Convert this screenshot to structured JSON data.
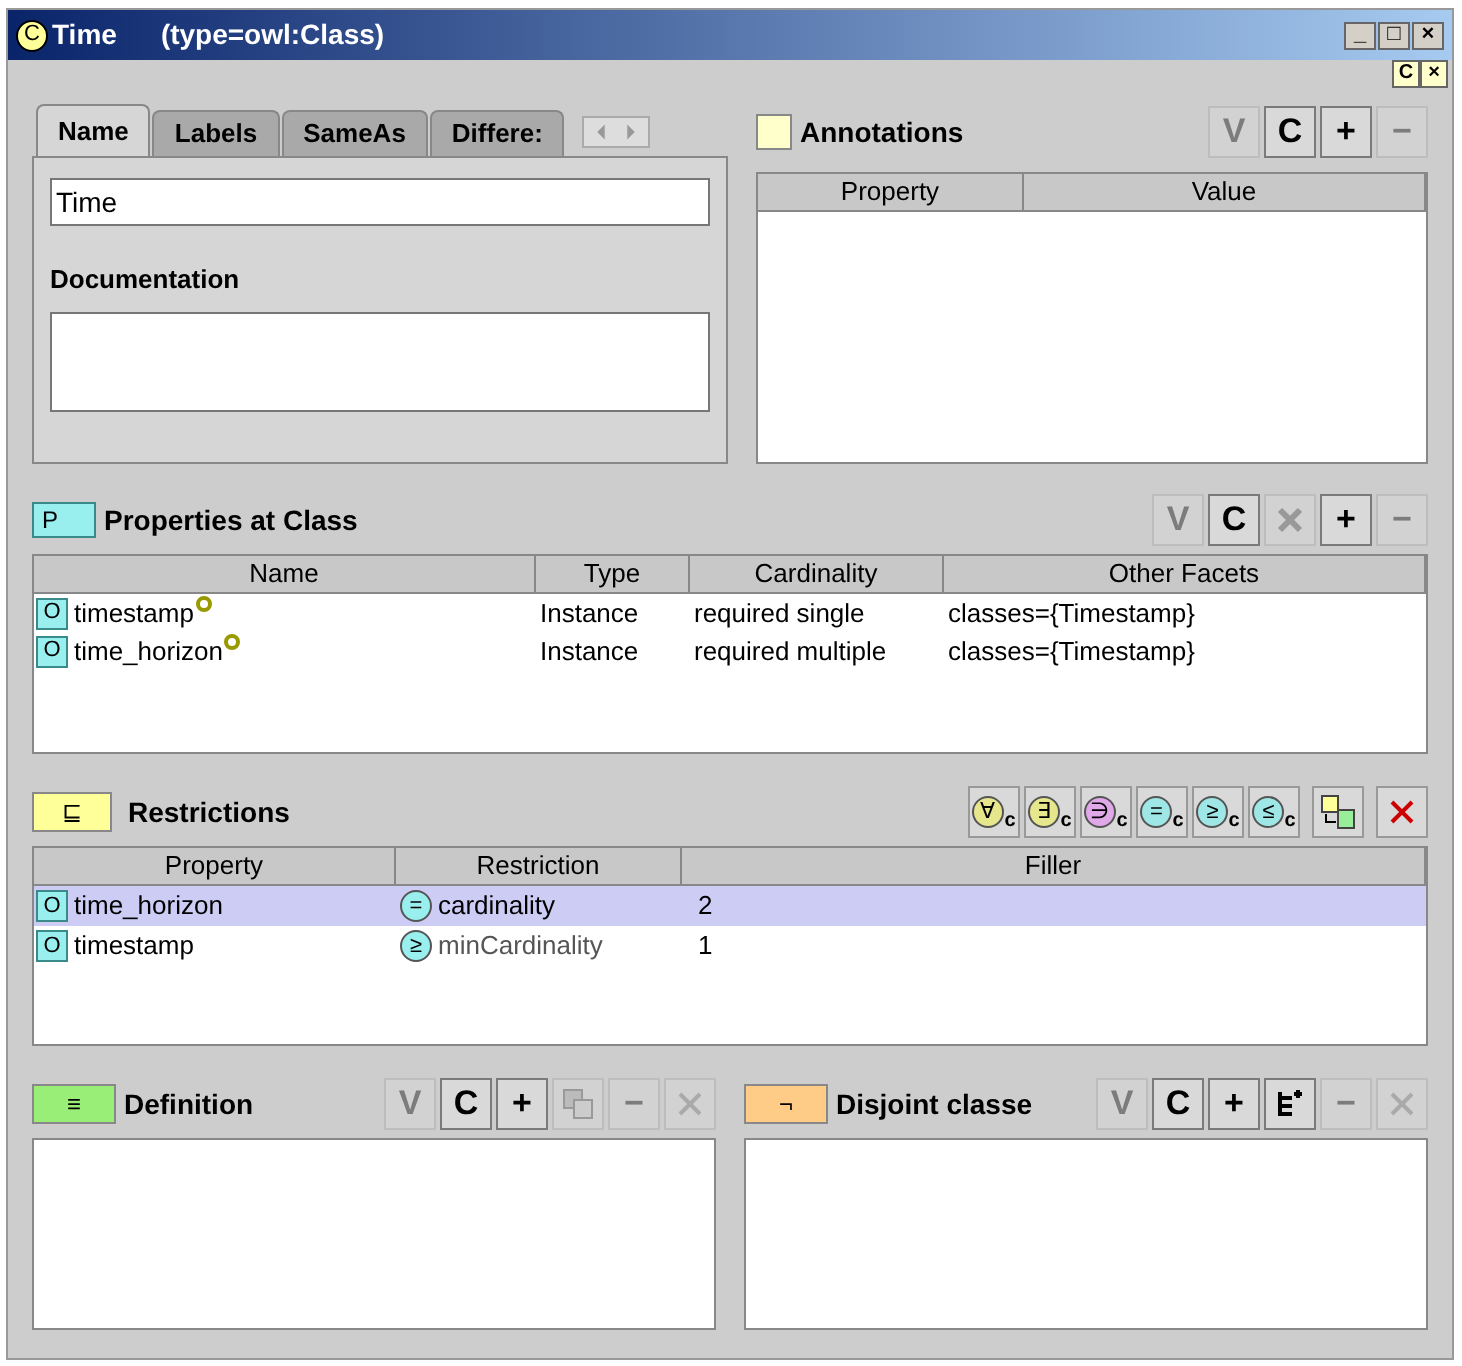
{
  "window": {
    "icon": "C",
    "title": "Time",
    "subtitle": "(type=owl:Class)",
    "controls": [
      "_",
      "□",
      "×"
    ],
    "sub_controls": [
      "C",
      "×"
    ]
  },
  "name_panel": {
    "tabs": [
      {
        "label": "Name",
        "selected": true
      },
      {
        "label": "Labels",
        "selected": false
      },
      {
        "label": "SameAs",
        "selected": false
      },
      {
        "label": "Differe:",
        "selected": false
      }
    ],
    "name_value": "Time",
    "documentation_label": "Documentation"
  },
  "annotations": {
    "title": "Annotations",
    "buttons": [
      {
        "kind": "text",
        "label": "V",
        "disabled": true
      },
      {
        "kind": "text",
        "label": "C",
        "disabled": false
      },
      {
        "kind": "text",
        "label": "+",
        "disabled": false
      },
      {
        "kind": "text",
        "label": "−",
        "disabled": true
      }
    ],
    "columns": [
      "Property",
      "Value"
    ]
  },
  "properties": {
    "icon": "P",
    "title": "Properties at Class",
    "buttons": [
      {
        "kind": "text",
        "label": "V",
        "disabled": true
      },
      {
        "kind": "text",
        "label": "C",
        "disabled": false
      },
      {
        "kind": "remove",
        "disabled": true
      },
      {
        "kind": "text",
        "label": "+",
        "disabled": false
      },
      {
        "kind": "text",
        "label": "−",
        "disabled": true
      }
    ],
    "columns": [
      "Name",
      "Type",
      "Cardinality",
      "Other Facets"
    ],
    "rows": [
      {
        "icon": "O",
        "name": "timestamp",
        "type": "Instance",
        "cardinality": "required single",
        "facets": "classes={Timestamp}"
      },
      {
        "icon": "O",
        "name": "time_horizon",
        "type": "Instance",
        "cardinality": "required multiple",
        "facets": "classes={Timestamp}"
      }
    ]
  },
  "restrictions": {
    "icon": "⊑",
    "title": "Restrictions",
    "buttons": [
      {
        "symbol": "∀",
        "sub": "c",
        "color": "#e6e68c"
      },
      {
        "symbol": "∃",
        "sub": "c",
        "color": "#e6e68c"
      },
      {
        "symbol": "∋",
        "sub": "c",
        "color": "#e0a8e8"
      },
      {
        "symbol": "=",
        "sub": "c",
        "color": "#9fe6e6"
      },
      {
        "symbol": "≥",
        "sub": "c",
        "color": "#9fe6e6"
      },
      {
        "symbol": "≤",
        "sub": "c",
        "color": "#9fe6e6"
      }
    ],
    "columns": [
      "Property",
      "Restriction",
      "Filler"
    ],
    "rows": [
      {
        "icon": "O",
        "property": "time_horizon",
        "symbol": "=",
        "restriction": "cardinality",
        "filler": "2",
        "selected": true
      },
      {
        "icon": "O",
        "property": "timestamp",
        "symbol": "≥",
        "restriction": "minCardinality",
        "filler": "1",
        "selected": false
      }
    ]
  },
  "definition": {
    "icon": "≡",
    "title": "Definition",
    "buttons": [
      {
        "kind": "text",
        "label": "V",
        "disabled": true
      },
      {
        "kind": "text",
        "label": "C",
        "disabled": false
      },
      {
        "kind": "text",
        "label": "+",
        "disabled": false
      },
      {
        "kind": "copy",
        "disabled": true
      },
      {
        "kind": "text",
        "label": "−",
        "disabled": true
      },
      {
        "kind": "delete",
        "disabled": true
      }
    ]
  },
  "disjoint": {
    "icon": "¬",
    "title": "Disjoint classe",
    "buttons": [
      {
        "kind": "text",
        "label": "V",
        "disabled": true
      },
      {
        "kind": "text",
        "label": "C",
        "disabled": false
      },
      {
        "kind": "text",
        "label": "+",
        "disabled": false
      },
      {
        "kind": "tree",
        "disabled": false
      },
      {
        "kind": "text",
        "label": "−",
        "disabled": true
      },
      {
        "kind": "delete",
        "disabled": true
      }
    ]
  }
}
